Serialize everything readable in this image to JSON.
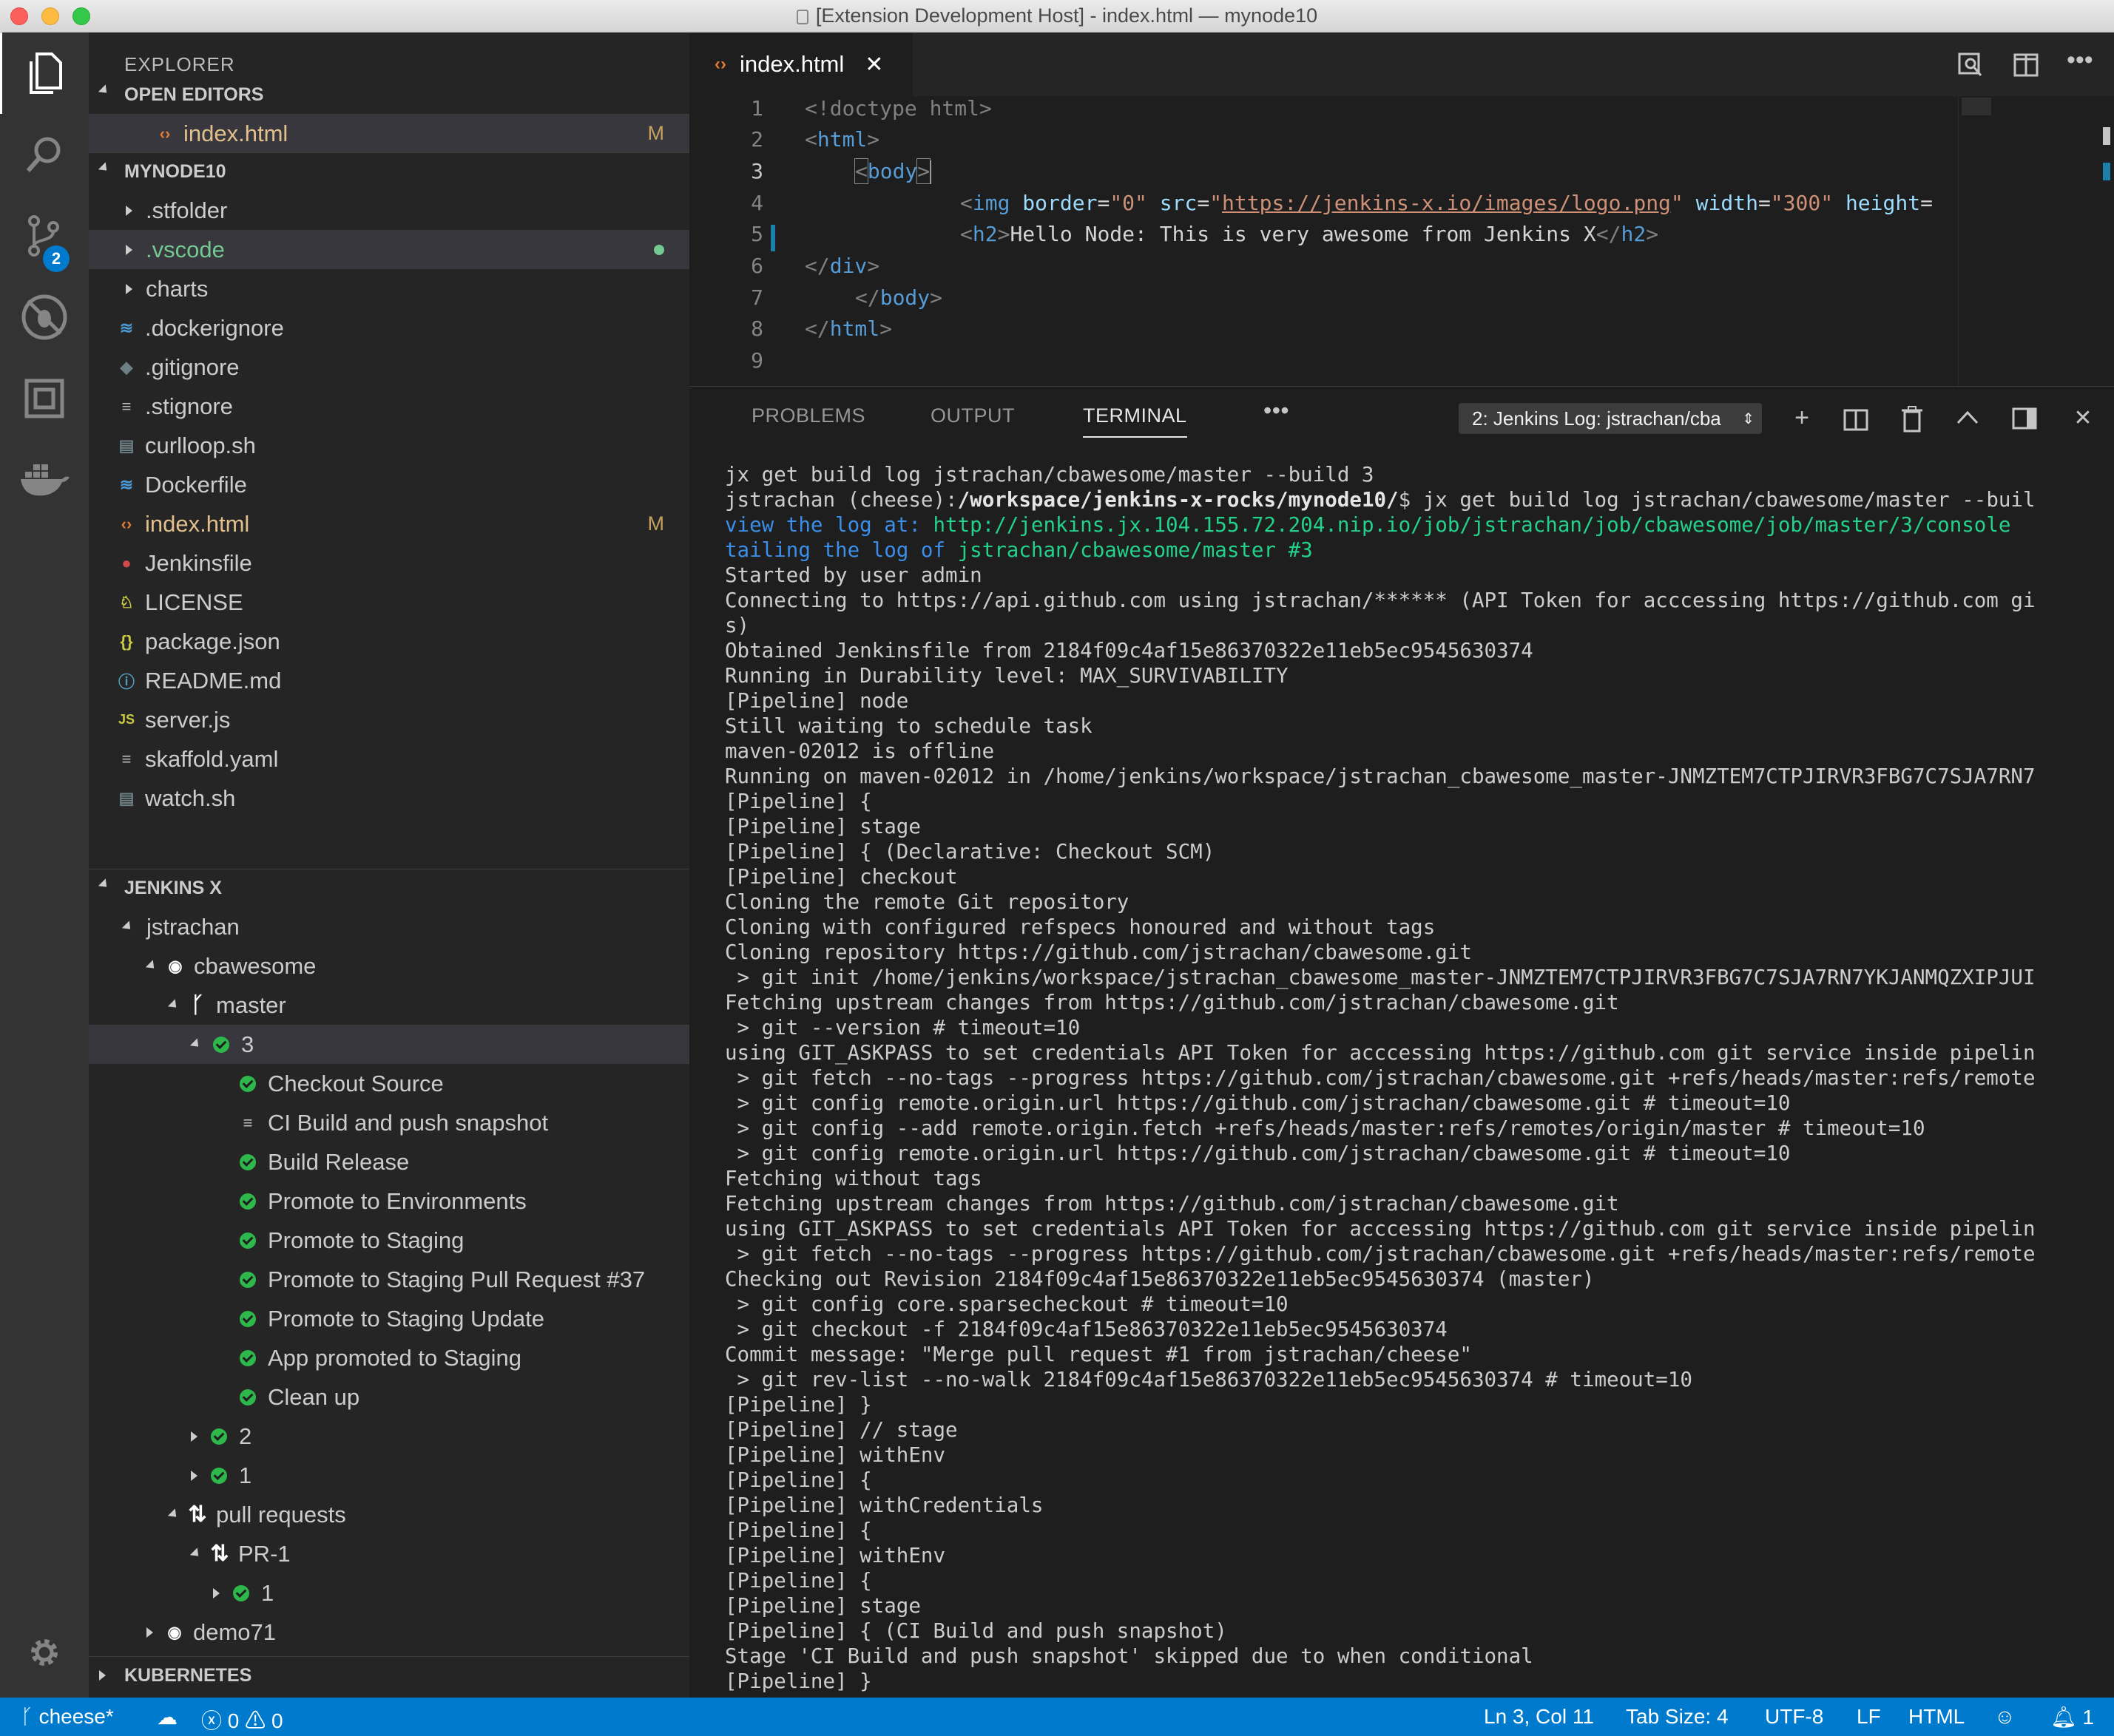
{
  "window": {
    "title": "[Extension Development Host] - index.html — mynode10"
  },
  "activity_bar": {
    "scm_badge": "2"
  },
  "explorer": {
    "title": "EXPLORER",
    "open_editors": {
      "header": "OPEN EDITORS",
      "items": [
        {
          "name": "index.html",
          "status": "M"
        }
      ]
    },
    "project": {
      "header": "MYNODE10",
      "items": [
        {
          "name": ".stfolder",
          "status": ""
        },
        {
          "name": ".vscode",
          "status": ""
        },
        {
          "name": "charts",
          "status": ""
        },
        {
          "name": ".dockerignore",
          "status": ""
        },
        {
          "name": ".gitignore",
          "status": ""
        },
        {
          "name": ".stignore",
          "status": ""
        },
        {
          "name": "curlloop.sh",
          "status": ""
        },
        {
          "name": "Dockerfile",
          "status": ""
        },
        {
          "name": "index.html",
          "status": "M"
        },
        {
          "name": "Jenkinsfile",
          "status": ""
        },
        {
          "name": "LICENSE",
          "status": ""
        },
        {
          "name": "package.json",
          "status": ""
        },
        {
          "name": "README.md",
          "status": ""
        },
        {
          "name": "server.js",
          "status": ""
        },
        {
          "name": "skaffold.yaml",
          "status": ""
        },
        {
          "name": "watch.sh",
          "status": ""
        }
      ]
    },
    "jenkins": {
      "header": "JENKINS X",
      "owner": "jstrachan",
      "repo": "cbawesome",
      "branch": "master",
      "build": "3",
      "stages": [
        "Checkout Source",
        "CI Build and push snapshot",
        "Build Release",
        "Promote to Environments",
        "Promote to Staging",
        "Promote to Staging Pull Request #37",
        "Promote to Staging Update",
        "App promoted to Staging",
        "Clean up"
      ],
      "build_2": "2",
      "build_1": "1",
      "pull_requests": "pull requests",
      "pr": "PR-1",
      "pr_build": "1",
      "other_repo": "demo71"
    },
    "kubernetes_header": "KUBERNETES"
  },
  "editor": {
    "tab": "index.html",
    "line_numbers": [
      "1",
      "2",
      "3",
      "4",
      "5",
      "6",
      "7",
      "8",
      "9"
    ],
    "code": {
      "l1": "<!doctype html>",
      "l2_tag": "html",
      "l3_tag": "body",
      "l4_tag": "img",
      "l4_attr1": "border",
      "l4_val1": "\"0\"",
      "l4_attr2": "src",
      "l4_val2_q": "\"",
      "l4_url": "https://jenkins-x.io/images/logo.png",
      "l4_attr3": "width",
      "l4_val3": "\"300\"",
      "l4_attr4": "height",
      "l5_tag": "h2",
      "l5_text": "Hello Node: This is very awesome from Jenkins X",
      "l6_tag": "div",
      "l7_tag": "body",
      "l8_tag": "html"
    }
  },
  "panel": {
    "tabs": [
      "PROBLEMS",
      "OUTPUT",
      "TERMINAL"
    ],
    "terminal_select": "2: Jenkins Log: jstrachan/cba",
    "terminal": {
      "cmd": "jx get build log jstrachan/cbawesome/master --build 3",
      "prompt_user": "jstrachan (cheese):",
      "prompt_path": "/workspace/jenkins-x-rocks/mynode10/",
      "prompt_cmd": "$ jx get build log jstrachan/cbawesome/master --buil",
      "view_label": "view the log at: ",
      "view_url": "http://jenkins.jx.104.155.72.204.nip.io/job/jstrachan/job/cbawesome/job/master/3/console",
      "tail_label": "tailing the log of ",
      "tail_target": "jstrachan/cbawesome/master #3",
      "lines": [
        "Started by user admin",
        "Connecting to https://api.github.com using jstrachan/****** (API Token for acccessing https://github.com gi",
        "s)",
        "Obtained Jenkinsfile from 2184f09c4af15e86370322e11eb5ec9545630374",
        "Running in Durability level: MAX_SURVIVABILITY",
        "[Pipeline] node",
        "Still waiting to schedule task",
        "maven-02012 is offline",
        "Running on maven-02012 in /home/jenkins/workspace/jstrachan_cbawesome_master-JNMZTEM7CTPJIRVR3FBG7C7SJA7RN7",
        "[Pipeline] {",
        "[Pipeline] stage",
        "[Pipeline] { (Declarative: Checkout SCM)",
        "[Pipeline] checkout",
        "Cloning the remote Git repository",
        "Cloning with configured refspecs honoured and without tags",
        "Cloning repository https://github.com/jstrachan/cbawesome.git",
        " > git init /home/jenkins/workspace/jstrachan_cbawesome_master-JNMZTEM7CTPJIRVR3FBG7C7SJA7RN7YKJANMQZXIPJUI",
        "Fetching upstream changes from https://github.com/jstrachan/cbawesome.git",
        " > git --version # timeout=10",
        "using GIT_ASKPASS to set credentials API Token for acccessing https://github.com git service inside pipelin",
        " > git fetch --no-tags --progress https://github.com/jstrachan/cbawesome.git +refs/heads/master:refs/remote",
        " > git config remote.origin.url https://github.com/jstrachan/cbawesome.git # timeout=10",
        " > git config --add remote.origin.fetch +refs/heads/master:refs/remotes/origin/master # timeout=10",
        " > git config remote.origin.url https://github.com/jstrachan/cbawesome.git # timeout=10",
        "Fetching without tags",
        "Fetching upstream changes from https://github.com/jstrachan/cbawesome.git",
        "using GIT_ASKPASS to set credentials API Token for acccessing https://github.com git service inside pipelin",
        " > git fetch --no-tags --progress https://github.com/jstrachan/cbawesome.git +refs/heads/master:refs/remote",
        "Checking out Revision 2184f09c4af15e86370322e11eb5ec9545630374 (master)",
        " > git config core.sparsecheckout # timeout=10",
        " > git checkout -f 2184f09c4af15e86370322e11eb5ec9545630374",
        "Commit message: \"Merge pull request #1 from jstrachan/cheese\"",
        " > git rev-list --no-walk 2184f09c4af15e86370322e11eb5ec9545630374 # timeout=10",
        "[Pipeline] }",
        "[Pipeline] // stage",
        "[Pipeline] withEnv",
        "[Pipeline] {",
        "[Pipeline] withCredentials",
        "[Pipeline] {",
        "[Pipeline] withEnv",
        "[Pipeline] {",
        "[Pipeline] stage",
        "[Pipeline] { (CI Build and push snapshot)",
        "Stage 'CI Build and push snapshot' skipped due to when conditional",
        "[Pipeline] }"
      ]
    }
  },
  "status_bar": {
    "branch": "cheese*",
    "errors": "0",
    "warnings": "0",
    "position": "Ln 3, Col 11",
    "tab_size": "Tab Size: 4",
    "encoding": "UTF-8",
    "eol": "LF",
    "language": "HTML",
    "notifications": "1"
  }
}
